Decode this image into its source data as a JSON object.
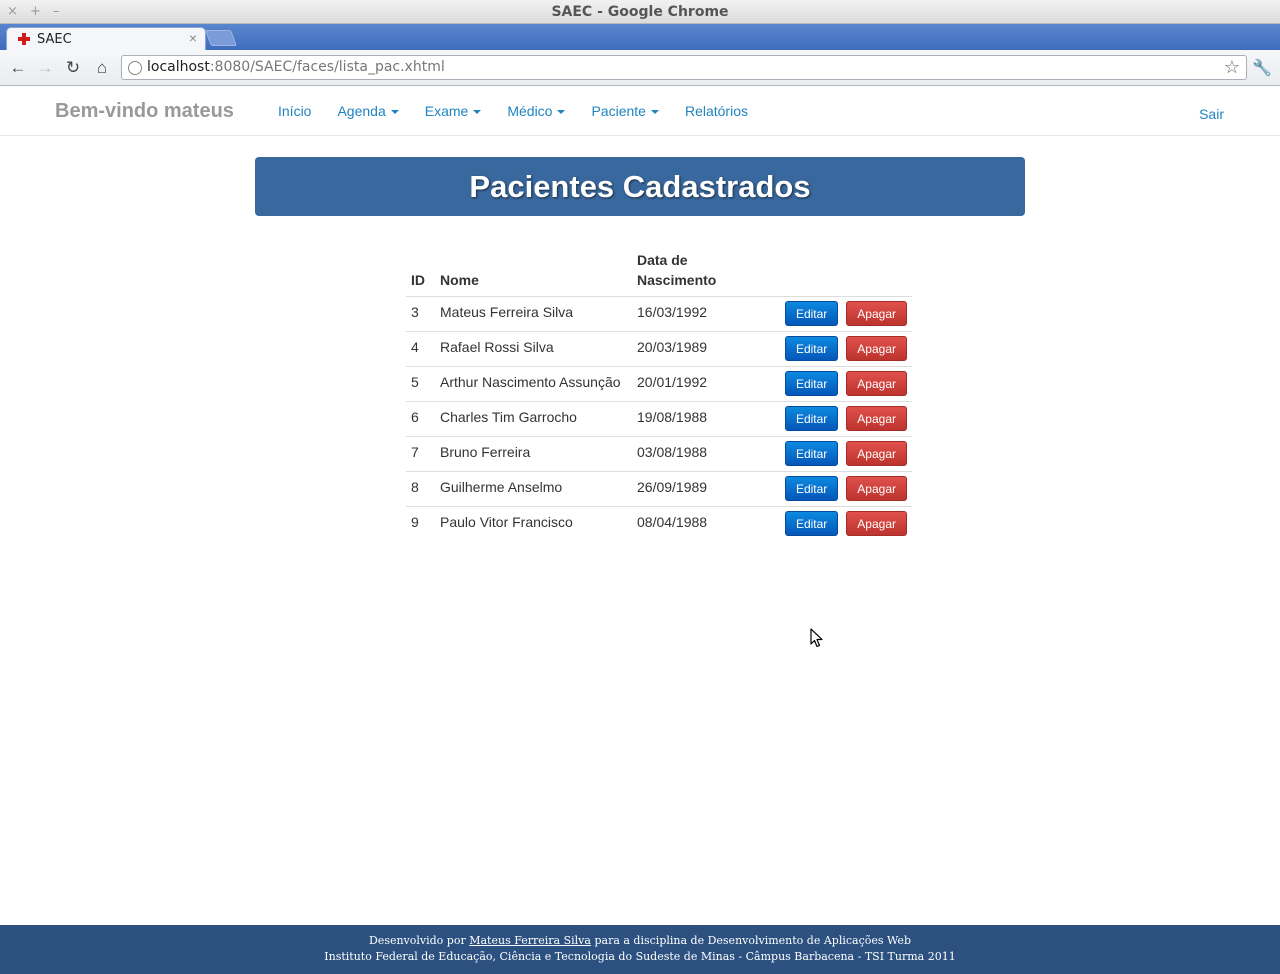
{
  "window": {
    "title": "SAEC - Google Chrome",
    "controls": [
      "×",
      "+",
      "–"
    ]
  },
  "tab": {
    "title": "SAEC",
    "close": "×"
  },
  "address_bar": {
    "host": "localhost",
    "path": ":8080/SAEC/faces/lista_pac.xhtml"
  },
  "navbar": {
    "brand": "Bem-vindo mateus",
    "items": [
      {
        "label": "Início",
        "dropdown": false
      },
      {
        "label": "Agenda",
        "dropdown": true
      },
      {
        "label": "Exame",
        "dropdown": true
      },
      {
        "label": "Médico",
        "dropdown": true
      },
      {
        "label": "Paciente",
        "dropdown": true
      },
      {
        "label": "Relatórios",
        "dropdown": false
      }
    ],
    "logout": "Sair"
  },
  "page": {
    "title": "Pacientes Cadastrados"
  },
  "table": {
    "headers": {
      "id": "ID",
      "name": "Nome",
      "birth_line1": "Data de",
      "birth_line2": "Nascimento"
    },
    "rows": [
      {
        "id": "3",
        "name": "Mateus Ferreira Silva",
        "birth": "16/03/1992"
      },
      {
        "id": "4",
        "name": "Rafael Rossi Silva",
        "birth": "20/03/1989"
      },
      {
        "id": "5",
        "name": "Arthur Nascimento Assunção",
        "birth": "20/01/1992"
      },
      {
        "id": "6",
        "name": "Charles Tim Garrocho",
        "birth": "19/08/1988"
      },
      {
        "id": "7",
        "name": "Bruno Ferreira",
        "birth": "03/08/1988"
      },
      {
        "id": "8",
        "name": "Guilherme Anselmo",
        "birth": "26/09/1989"
      },
      {
        "id": "9",
        "name": "Paulo Vitor Francisco",
        "birth": "08/04/1988"
      }
    ],
    "edit_label": "Editar",
    "delete_label": "Apagar"
  },
  "footer": {
    "line1_prefix": "Desenvolvido por",
    "author": "Mateus Ferreira Silva",
    "line1_suffix": "para a disciplina de Desenvolvimento de Aplicações Web",
    "line2": "Instituto Federal de Educação, Ciência e Tecnologia do Sudeste de Minas - Câmpus Barbacena - TSI Turma 2011"
  },
  "colors": {
    "heading_bg": "#39689e",
    "link": "#1f84c0",
    "edit_button": "#0556b9",
    "delete_button": "#bd332e",
    "footer_bg": "#2c5180"
  },
  "icons": [
    "favicon-red-cross-icon",
    "back-icon",
    "forward-icon",
    "reload-icon",
    "home-icon",
    "globe-icon",
    "star-icon",
    "wrench-icon",
    "caret-down-icon",
    "mouse-cursor-icon"
  ]
}
